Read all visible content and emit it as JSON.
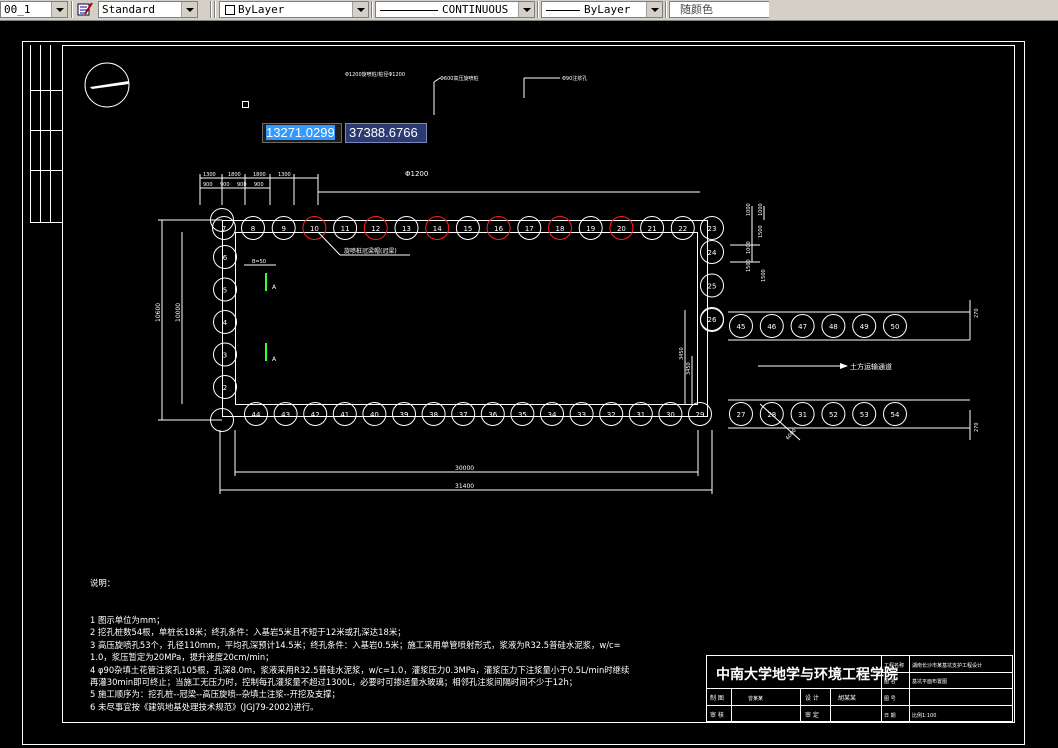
{
  "toolbar": {
    "layer_combo": "00_1",
    "text_style": "Standard",
    "layer_name": "ByLayer",
    "linetype": "CONTINUOUS",
    "lineweight": "ByLayer",
    "color": "随颜色"
  },
  "coords": {
    "x": "13271.0299",
    "y": "37388.6766"
  },
  "callouts": {
    "top_a": "Φ1200旋喷桩/桩径Φ1200",
    "top_b": "Φ600高压旋喷桩",
    "top_c": "Φ90注浆孔",
    "pile_dia": "Φ1200",
    "cap_beam": "旋喷桩冠梁帽(冠梁)",
    "earth_road": "土方运输通道",
    "section_mark": "A",
    "spacing_note": "B=50"
  },
  "dims": {
    "top": [
      "1300",
      "1800",
      "1800",
      "1300"
    ],
    "top_sub": [
      "900",
      "900",
      "900",
      "900"
    ],
    "left_outer": "10600",
    "left_inner": "10000",
    "bottom_inner": "30000",
    "bottom_outer": "31400",
    "right_a": "1000",
    "right_b": "1000",
    "right_c": "1000",
    "right_d": "1500",
    "right_e": "1500",
    "right_f": "1500",
    "right_tail_top": "270",
    "right_tail_bot": "270",
    "inner_a": "3450",
    "inner_b": "3450",
    "diag": "6000"
  },
  "piles": {
    "top_row": [
      "7",
      "8",
      "9",
      "10",
      "11",
      "12",
      "13",
      "14",
      "15",
      "16",
      "17",
      "18",
      "19",
      "20",
      "21",
      "22",
      "23"
    ],
    "right_col": [
      "24",
      "25",
      "26"
    ],
    "ext_top": [
      "45",
      "46",
      "47",
      "48",
      "49",
      "50"
    ],
    "left_col": [
      "6",
      "5",
      "4",
      "3",
      "2"
    ],
    "bottom_row": [
      "44",
      "43",
      "42",
      "41",
      "40",
      "39",
      "38",
      "37",
      "36",
      "35",
      "34",
      "33",
      "32",
      "31",
      "30",
      "29"
    ],
    "ext_bottom": [
      "27",
      "28",
      "31",
      "52",
      "53",
      "54"
    ],
    "red_top": [
      "10",
      "12",
      "14",
      "16",
      "18",
      "20"
    ]
  },
  "notes": {
    "title": "说明：",
    "lines": [
      "1 图示单位为mm；",
      "2 挖孔桩数54根，单桩长18米；终孔条件：入基岩5米且不短于12米或孔深达18米；",
      "3 高压旋喷孔53个，孔径110mm，平均孔深预计14.5米；终孔条件：入基岩0.5米；施工采用单管喷射形式，浆液为R32.5普硅水泥浆，w/c=",
      "1.0，浆压暂定为20MPa，提升速度20cm/min；",
      "4 φ90杂填土花管注浆孔105根，孔深8.0m，浆液采用R32.5普硅水泥浆，w/c=1.0，灌浆压力0.3MPa，灌浆压力下注浆量小于0.5L/min时继续",
      "再灌30min即可终止；当施工无压力时，控制每孔灌浆量不超过1300L，必要时可掺适量水玻璃；相邻孔注浆间隔时间不少于12h；",
      "5 施工顺序为：挖孔桩--冠梁--高压旋喷--杂填土注浆--开挖及支撑；",
      "6 未尽事宜按《建筑地基处理技术规范》(JGJ79-2002)进行。"
    ]
  },
  "title_block": {
    "school": "中南大学地学与环境工程学院",
    "label_project": "工程名称",
    "project": "湖南长沙市某基坑支护工程设计",
    "label_drawing": "图 名",
    "drawing": "基坑平面布置图",
    "label_draw": "制 图",
    "drawer": "曾某某",
    "label_design": "设 计",
    "designer": "胡某某",
    "label_num": "图 号",
    "label_check": "审 核",
    "label_approve": "审 定",
    "label_scale": "日 期",
    "scale": "比例1:100"
  },
  "colors": {
    "background": "#000000",
    "lines": "#ffffff",
    "red_pile": "#ff2020",
    "section": "#33ff33",
    "coord_sel": "#3399ff",
    "coord_box": "#2c3a72"
  }
}
